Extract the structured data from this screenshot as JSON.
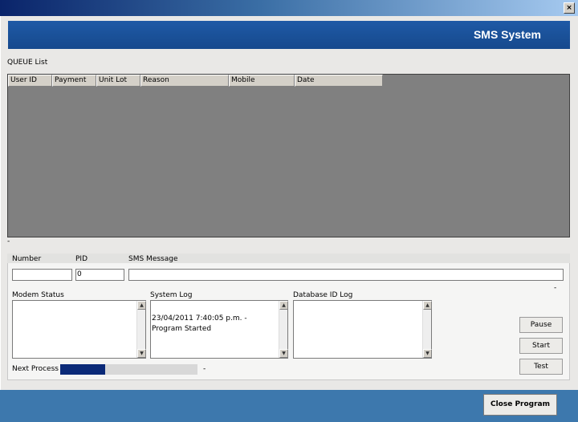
{
  "window": {
    "close_glyph": "×"
  },
  "banner": {
    "title": "SMS System"
  },
  "queue": {
    "label": "QUEUE List",
    "columns": [
      "User ID",
      "Payment",
      "Unit Lot",
      "Reason",
      "Mobile",
      "Date"
    ],
    "status_dash": "-"
  },
  "fields": {
    "number_label": "Number",
    "pid_label": "PID",
    "pid_value": "0",
    "sms_label": "SMS Message",
    "sms_dash": "-"
  },
  "logs": {
    "modem_label": "Modem Status",
    "system_label": "System Log",
    "system_entry": "23/04/2011 7:40:05 p.m. - Program Started",
    "database_label": "Database ID Log"
  },
  "buttons": {
    "pause": "Pause",
    "start": "Start",
    "test": "Test",
    "close_program": "Close Program"
  },
  "progress": {
    "label": "Next Process",
    "value_fraction": 0.33,
    "dash": "-"
  },
  "colors": {
    "banner": "#16498d",
    "footer": "#3d78ad",
    "progress": "#0b2a78"
  },
  "icons": {
    "scroll_up": "▲",
    "scroll_down": "▼"
  }
}
